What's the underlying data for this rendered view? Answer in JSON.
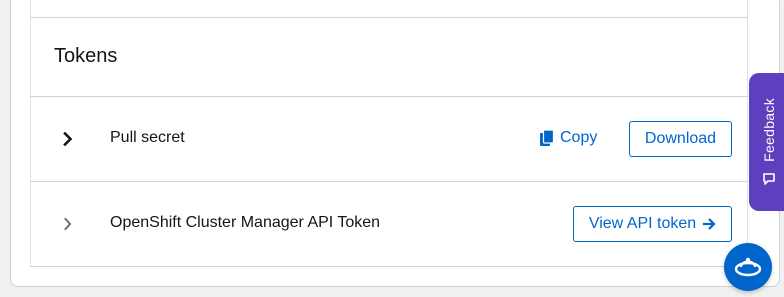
{
  "tokens": {
    "title": "Tokens",
    "rows": [
      {
        "label": "Pull secret",
        "copy_label": "Copy",
        "download_label": "Download"
      },
      {
        "label": "OpenShift Cluster Manager API Token",
        "view_label": "View API token"
      }
    ]
  },
  "feedback": {
    "label": "Feedback"
  },
  "icons": {
    "toggle": "chevron-right-icon",
    "copy": "copy-icon",
    "arrow": "arrow-right-icon",
    "feedback": "comment-icon",
    "chat": "chat-assistant-icon"
  },
  "colors": {
    "link": "#0066cc",
    "feedback_bg": "#5e40be",
    "text": "#151515"
  }
}
